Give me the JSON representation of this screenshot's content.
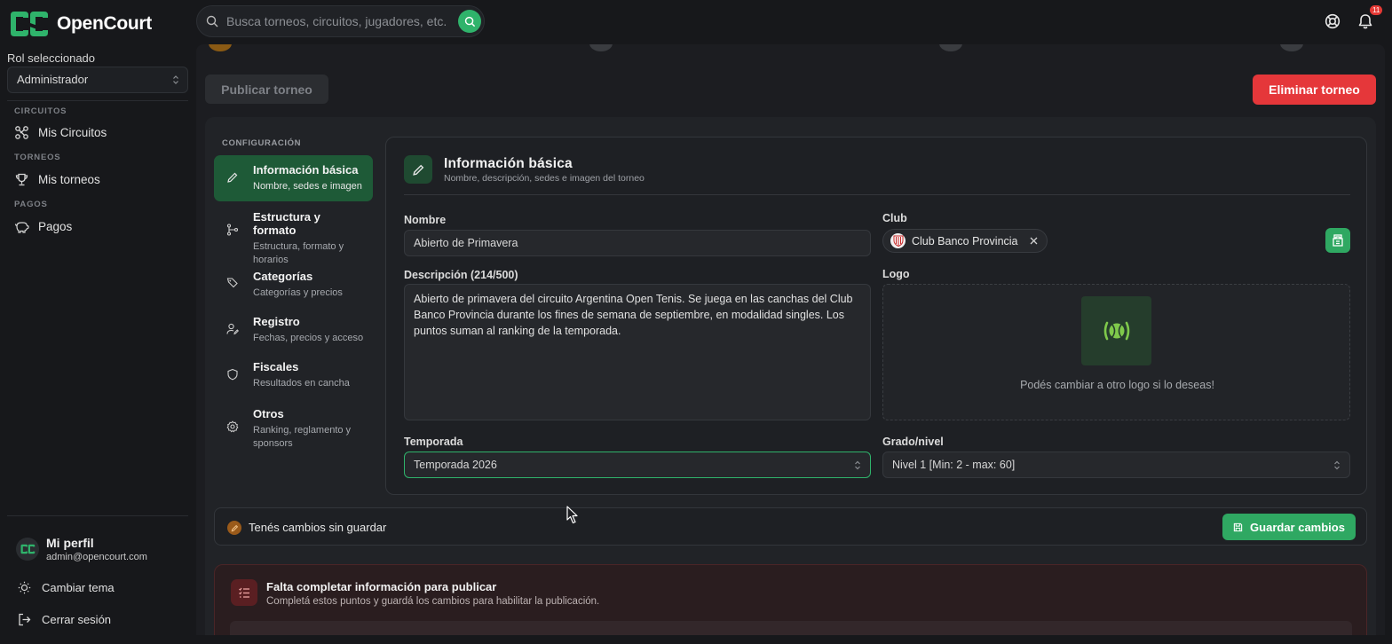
{
  "brand": {
    "name": "OpenCourt"
  },
  "search": {
    "placeholder": "Busca torneos, circuitos, jugadores, etc."
  },
  "notifications": {
    "count": "11"
  },
  "sidebar": {
    "role_label": "Rol seleccionado",
    "role_value": "Administrador",
    "sections": [
      {
        "heading": "CIRCUITOS",
        "item": "Mis Circuitos"
      },
      {
        "heading": "TORNEOS",
        "item": "Mis torneos"
      },
      {
        "heading": "PAGOS",
        "item": "Pagos"
      }
    ],
    "profile": {
      "name": "Mi perfil",
      "email": "admin@opencourt.com"
    },
    "theme_label": "Cambiar tema",
    "logout_label": "Cerrar sesión"
  },
  "actions": {
    "publish": "Publicar torneo",
    "delete": "Eliminar torneo"
  },
  "config": {
    "heading": "CONFIGURACIÓN",
    "items": [
      {
        "title": "Información básica",
        "subtitle": "Nombre, sedes e imagen"
      },
      {
        "title": "Estructura y formato",
        "subtitle": "Estructura, formato y horarios"
      },
      {
        "title": "Categorías",
        "subtitle": "Categorías y precios"
      },
      {
        "title": "Registro",
        "subtitle": "Fechas, precios y acceso"
      },
      {
        "title": "Fiscales",
        "subtitle": "Resultados en cancha"
      },
      {
        "title": "Otros",
        "subtitle": "Ranking, reglamento y sponsors"
      }
    ]
  },
  "form": {
    "title": "Información básica",
    "subtitle": "Nombre, descripción, sedes e imagen del torneo",
    "name_label": "Nombre",
    "name_value": "Abierto de Primavera",
    "club_label": "Club",
    "club_value": "Club Banco Provincia",
    "description_label": "Descripción (214/500)",
    "description_value": "Abierto de primavera del circuito Argentina Open Tenis. Se juega en las canchas del Club Banco Provincia durante los fines de semana de septiembre, en modalidad singles. Los puntos suman al ranking de la temporada.",
    "logo_label": "Logo",
    "logo_hint": "Podés cambiar a otro logo si lo deseas!",
    "season_label": "Temporada",
    "season_value": "Temporada 2026",
    "grade_label": "Grado/nivel",
    "grade_value": "Nivel 1 [Min: 2 - max: 60]"
  },
  "unsaved": {
    "text": "Tenés cambios sin guardar",
    "save": "Guardar cambios"
  },
  "warning": {
    "title": "Falta completar información para publicar",
    "subtitle": "Completá estos puntos y guardá los cambios para habilitar la publicación."
  },
  "colors": {
    "accent": "#2fa862",
    "danger": "#e5373a",
    "active_nav": "#1e5a37"
  }
}
